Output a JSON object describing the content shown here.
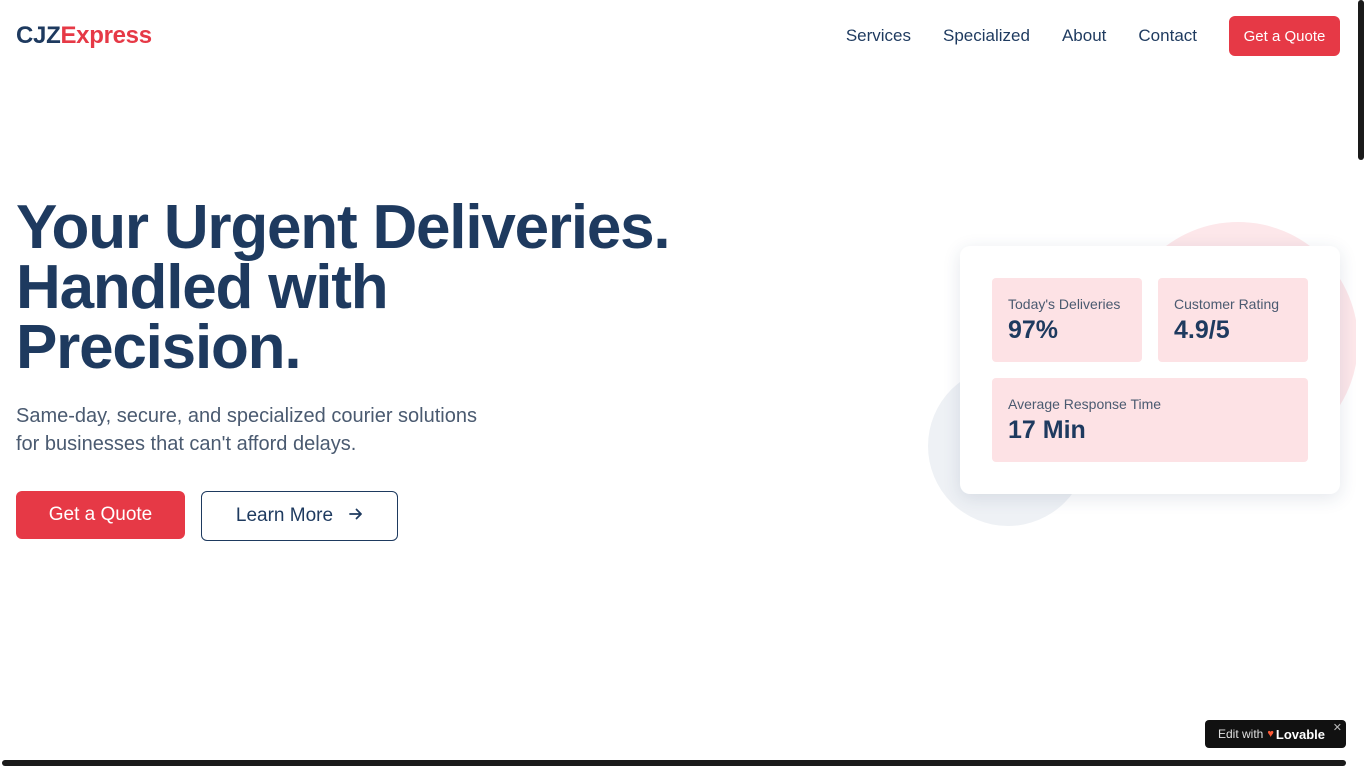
{
  "brand": {
    "logo_part1": "CJZ",
    "logo_part2": "Express",
    "primary_color": "#1e3a5f",
    "accent_color": "#e63946"
  },
  "nav": {
    "items": [
      "Services",
      "Specialized",
      "About",
      "Contact"
    ],
    "cta_label": "Get a Quote"
  },
  "hero": {
    "title_lines": [
      "Your Urgent Deliveries.",
      "Handled with",
      "Precision."
    ],
    "subtitle_lines": [
      "Same-day, secure, and specialized courier solutions",
      "for businesses that can't afford delays."
    ],
    "primary_button": "Get a Quote",
    "secondary_button": "Learn More",
    "secondary_icon": "arrow-right-icon"
  },
  "stats": [
    {
      "label": "Today's Deliveries",
      "value": "97%"
    },
    {
      "label": "Customer Rating",
      "value": "4.9/5"
    },
    {
      "label": "Average Response Time",
      "value": "17 Min"
    }
  ],
  "badge": {
    "text": "Edit with",
    "brand": "Lovable",
    "icon": "lovable-heart-icon",
    "close_icon": "close-icon"
  }
}
